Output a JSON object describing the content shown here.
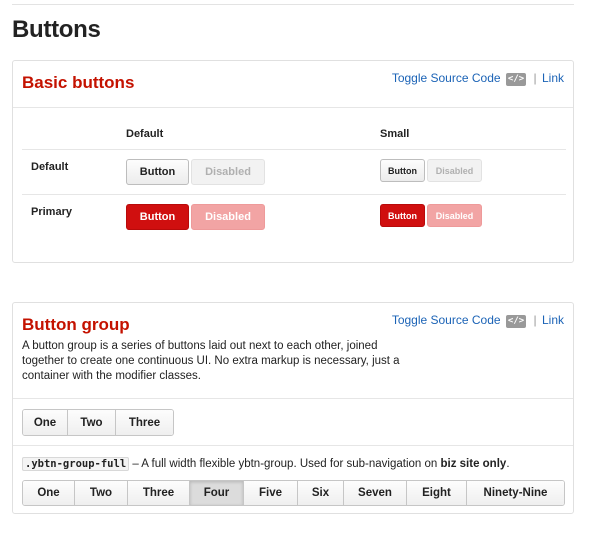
{
  "page": {
    "title": "Buttons"
  },
  "basic": {
    "title": "Basic buttons",
    "toggle_label": "Toggle Source Code",
    "code_icon": "</>",
    "separator": "|",
    "link_label": "Link",
    "col_default": "Default",
    "col_small": "Small",
    "rows": [
      {
        "label": "Default",
        "button": "Button",
        "disabled": "Disabled",
        "small_button": "Button",
        "small_disabled": "Disabled"
      },
      {
        "label": "Primary",
        "button": "Button",
        "disabled": "Disabled",
        "small_button": "Button",
        "small_disabled": "Disabled"
      }
    ]
  },
  "group": {
    "title": "Button group",
    "toggle_label": "Toggle Source Code",
    "code_icon": "</>",
    "separator": "|",
    "link_label": "Link",
    "description": "A button group is a series of buttons laid out next to each other, joined together to create one continuous UI. No extra markup is necessary, just a container with the modifier classes.",
    "small_group": [
      "One",
      "Two",
      "Three"
    ],
    "full_class": ".ybtn-group-full",
    "full_desc_before": " – A full width flexible ybtn-group. Used for sub-navigation on ",
    "full_desc_bold": "biz site only",
    "full_desc_after": ".",
    "full_group": [
      "One",
      "Two",
      "Three",
      "Four",
      "Five",
      "Six",
      "Seven",
      "Eight",
      "Ninety-Nine"
    ],
    "active": "Four"
  },
  "colors": {
    "accent": "#c41200",
    "primary": "#d00f0f",
    "link": "#1b63b6"
  }
}
